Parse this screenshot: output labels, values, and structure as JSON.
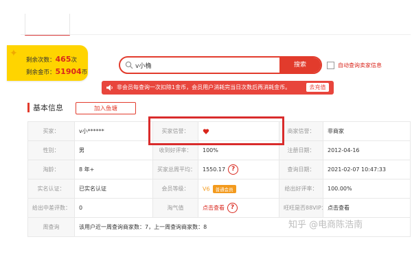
{
  "balance": {
    "times_label": "剩余次数：",
    "times_value": "465",
    "times_unit": "次",
    "coins_label": "剩余金币：",
    "coins_value": "51904",
    "coins_unit": "币"
  },
  "search": {
    "value": "v小桷",
    "button_label": "搜索"
  },
  "auto_check": {
    "label": "自动查询卖家信息"
  },
  "notice": {
    "text": "非会员每查询一次扣除1金币，会员用户消耗完当日次数后再消耗金币。",
    "recharge_label": "去充值"
  },
  "section": {
    "title": "基本信息",
    "add_button_label": "加入鱼塘"
  },
  "info_table": {
    "rows": [
      [
        {
          "key": "买家：",
          "value": "v小******"
        },
        {
          "key": "买家信誉：",
          "value": ""
        },
        {
          "key": "商家信誉：",
          "value": "非商家"
        }
      ],
      [
        {
          "key": "性别：",
          "value": "男"
        },
        {
          "key": "收到好评率：",
          "value": "100%"
        },
        {
          "key": "注册日期：",
          "value": "2012-04-16"
        }
      ],
      [
        {
          "key": "淘龄：",
          "value": "8 年+"
        },
        {
          "key": "买家总周平均：",
          "value": "1550.17"
        },
        {
          "key": "查询日期：",
          "value": "2021-02-07 10:47:33"
        }
      ],
      [
        {
          "key": "实名认证：",
          "value": "已实名认证"
        },
        {
          "key": "会员等级：",
          "value": "V6",
          "badge": "普通会员"
        },
        {
          "key": "给出好评率：",
          "value": "100.00%"
        }
      ],
      [
        {
          "key": "给出中差评数：",
          "value": "0"
        },
        {
          "key": "淘气值",
          "value": "点击查看"
        },
        {
          "key": "旺旺是否88VIP：",
          "value": "点击查看"
        }
      ],
      [
        {
          "key": "周查询",
          "value": "该用户近一周查询商家数：7，上一周查询商家数：8"
        }
      ]
    ]
  },
  "watermark": "知乎 @电商陈浩南",
  "colors": {
    "accent_red": "#e23b2c",
    "balance_yellow": "#ffd400",
    "vip_orange": "#f39a1d"
  }
}
